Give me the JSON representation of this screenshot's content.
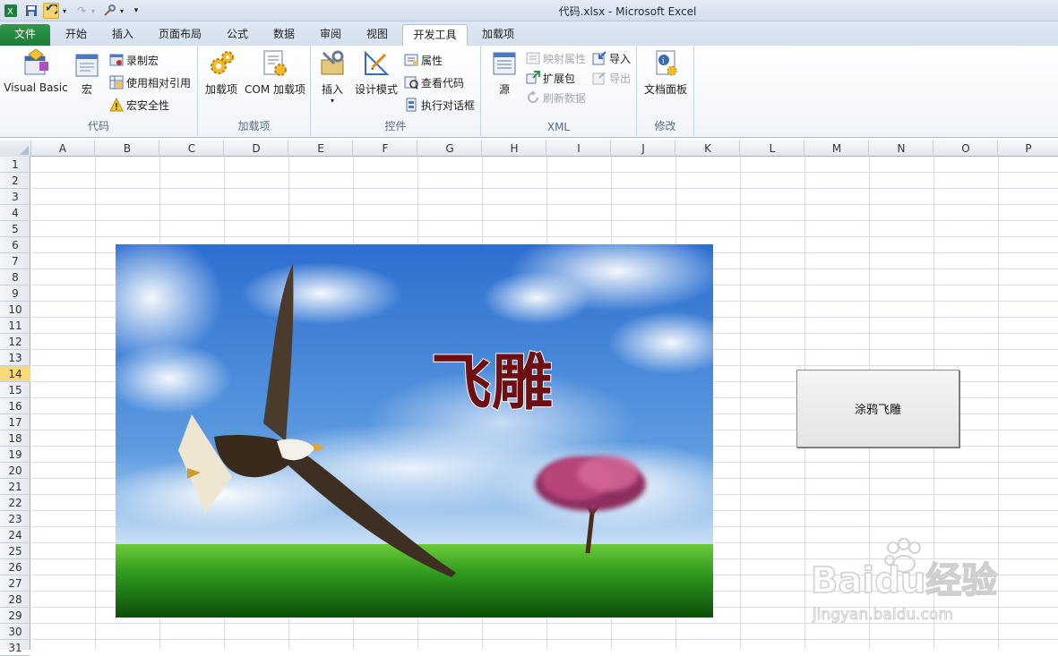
{
  "window": {
    "title": "代码.xlsx  -  Microsoft Excel"
  },
  "tabs": [
    {
      "label": "文件"
    },
    {
      "label": "开始"
    },
    {
      "label": "插入"
    },
    {
      "label": "页面布局"
    },
    {
      "label": "公式"
    },
    {
      "label": "数据"
    },
    {
      "label": "审阅"
    },
    {
      "label": "视图"
    },
    {
      "label": "开发工具"
    },
    {
      "label": "加载项"
    }
  ],
  "ribbon": {
    "code": {
      "label": "代码",
      "visual_basic": "Visual Basic",
      "macros": "宏",
      "record_macro": "录制宏",
      "relative_ref": "使用相对引用",
      "macro_security": "宏安全性"
    },
    "addins": {
      "label": "加载项",
      "addins": "加载项",
      "com_addins": "COM 加载项"
    },
    "controls": {
      "label": "控件",
      "insert": "插入",
      "design_mode": "设计模式",
      "properties": "属性",
      "view_code": "查看代码",
      "run_dialog": "执行对话框"
    },
    "xml": {
      "label": "XML",
      "source": "源",
      "map_props": "映射属性",
      "expansion_packs": "扩展包",
      "refresh_data": "刷新数据",
      "import": "导入",
      "export": "导出"
    },
    "modify": {
      "label": "修改",
      "doc_panel": "文档面板"
    }
  },
  "columns": [
    "A",
    "B",
    "C",
    "D",
    "E",
    "F",
    "G",
    "H",
    "I",
    "J",
    "K",
    "L",
    "M",
    "N",
    "O",
    "P"
  ],
  "rows": [
    "1",
    "2",
    "3",
    "4",
    "5",
    "6",
    "7",
    "8",
    "9",
    "10",
    "11",
    "12",
    "13",
    "14",
    "15",
    "16",
    "17",
    "18",
    "19",
    "20",
    "21",
    "22",
    "23",
    "24",
    "25",
    "26",
    "27",
    "28",
    "29",
    "30",
    "31"
  ],
  "selected_row": "14",
  "picture": {
    "caption": "飞雕"
  },
  "macro_button": {
    "label": "涂鸦飞雕"
  },
  "watermark": {
    "brand": "Baidu经验",
    "url": "jingyan.baidu.com"
  },
  "colors": {
    "file_tab": "#1f7d3a",
    "selected_row": "#f9d97c",
    "grid": "#d8dde5"
  }
}
